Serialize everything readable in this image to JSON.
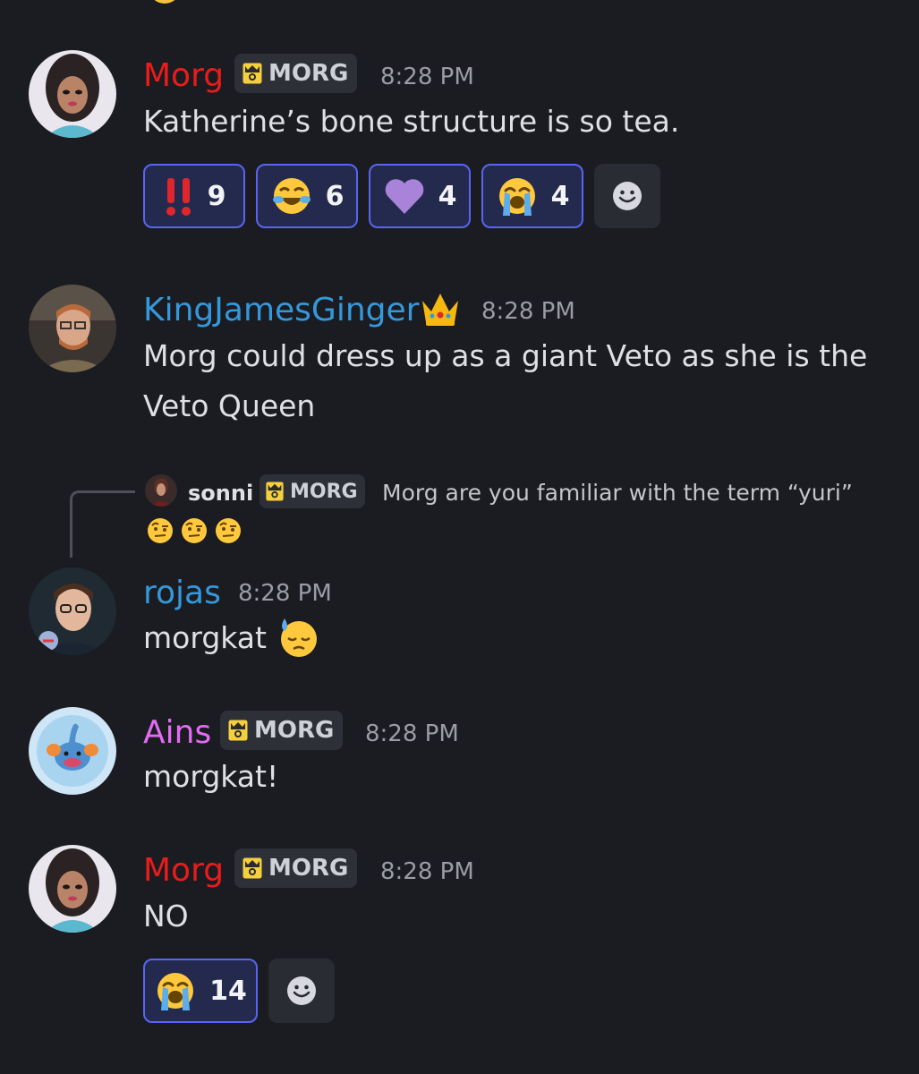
{
  "colors": {
    "background": "#1b1c21",
    "morg_name": "#e91c1c",
    "blue_name": "#3498db",
    "pink_name": "#e36bf5",
    "reaction_border": "#5865f2",
    "reaction_bg": "#242a4d"
  },
  "messages": [
    {
      "username": "Morg",
      "tag": "MORG",
      "timestamp": "8:28 PM",
      "text": "Katherine’s bone structure is so tea.",
      "reactions": [
        {
          "emoji": "‼",
          "count": "9"
        },
        {
          "emoji": "joy-face-icon",
          "count": "6"
        },
        {
          "emoji": "purple-heart-icon",
          "count": "4"
        },
        {
          "emoji": "loudly-crying-face-icon",
          "count": "4"
        }
      ]
    },
    {
      "username": "KingJamesGinger",
      "badge": "crown-icon",
      "timestamp": "8:28 PM",
      "lines": [
        "Morg could dress up as a giant Veto as she is the",
        "Veto Queen"
      ]
    },
    {
      "reply": {
        "username": "sonni",
        "tag": "MORG",
        "text": "Morg are you familiar with the term “yuri”",
        "emoji_line": "face-with-raised-eyebrow-icon x3"
      },
      "username": "rojas",
      "timestamp": "8:28 PM",
      "text": "morgkat",
      "emoji": "downcast-face-with-sweat-icon"
    },
    {
      "username": "Ains",
      "tag": "MORG",
      "timestamp": "8:28 PM",
      "text": "morgkat!"
    },
    {
      "username": "Morg",
      "tag": "MORG",
      "timestamp": "8:28 PM",
      "text": "NO",
      "reactions": [
        {
          "emoji": "loudly-crying-face-icon",
          "count": "14"
        }
      ]
    }
  ]
}
